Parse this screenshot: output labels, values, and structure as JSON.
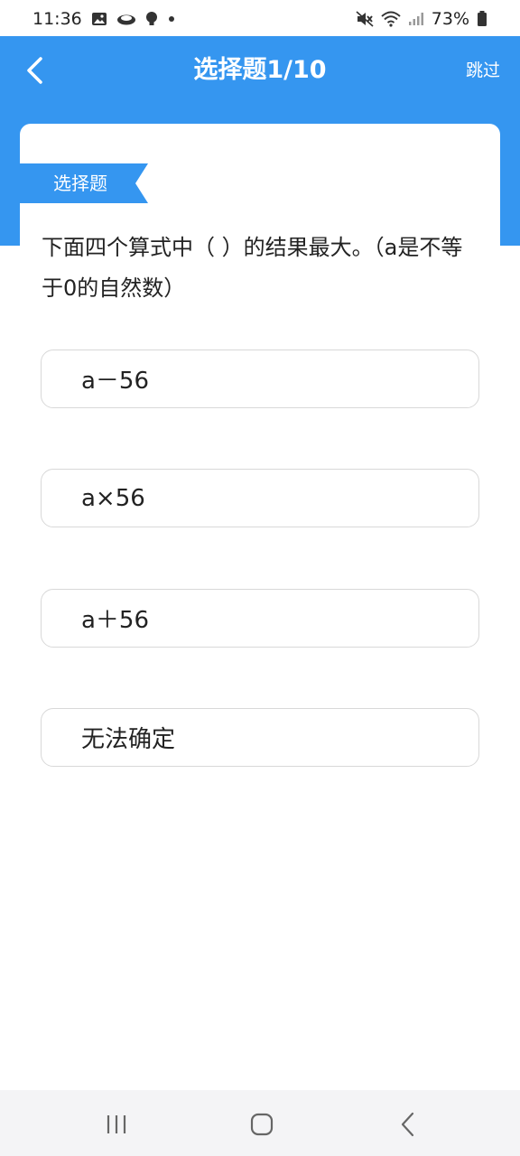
{
  "status": {
    "time": "11:36",
    "battery": "73%",
    "icons": [
      "image-icon",
      "cloud-icon",
      "bulb-icon",
      "dot-icon",
      "mute-icon",
      "wifi-icon",
      "signal-icon",
      "battery-icon"
    ]
  },
  "header": {
    "title": "选择题1/10",
    "skip_label": "跳过",
    "background": "#3596f0"
  },
  "question": {
    "type_tag": "选择题",
    "text": "下面四个算式中（ ）的结果最大。（a是不等于0的自然数）"
  },
  "options": [
    {
      "label": "a－56"
    },
    {
      "label": "a×56"
    },
    {
      "label": "a＋56"
    },
    {
      "label": "无法确定"
    }
  ],
  "nav": {
    "icons": [
      "recent-apps-icon",
      "home-icon",
      "back-icon"
    ]
  }
}
